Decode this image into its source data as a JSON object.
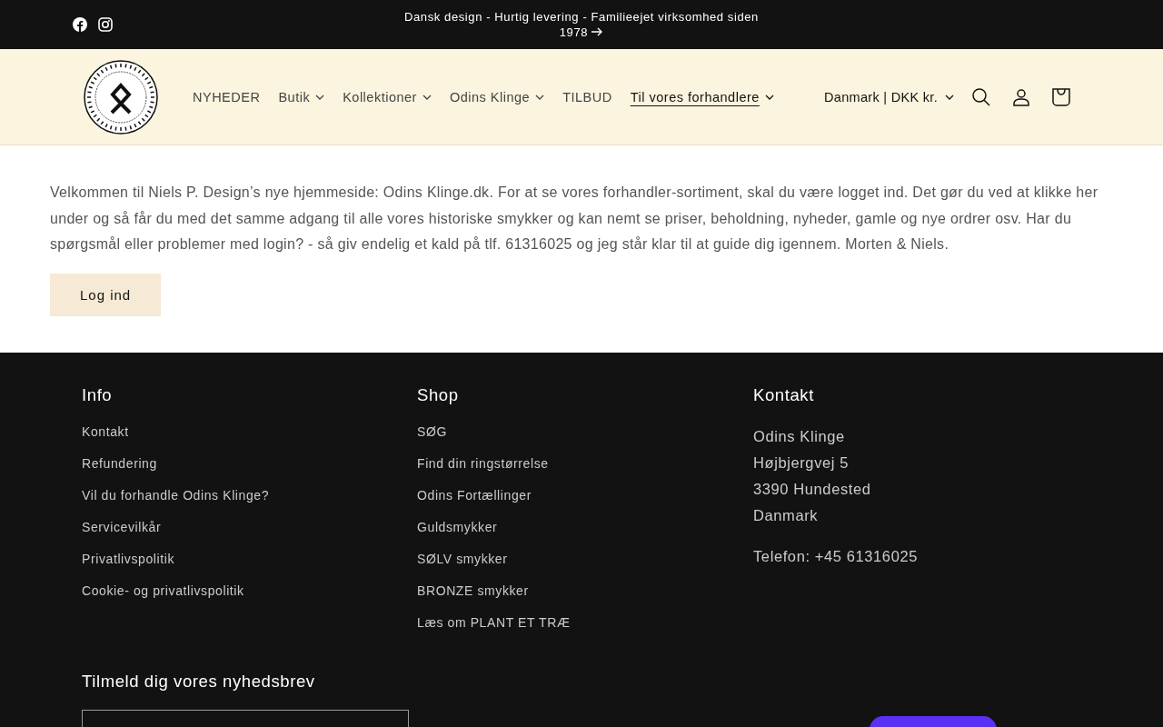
{
  "announcement": {
    "text": "Dansk design - Hurtig levering - Familieejet virksomhed siden 1978"
  },
  "header": {
    "nav": [
      {
        "label": "NYHEDER",
        "dropdown": false,
        "selected": false
      },
      {
        "label": "Butik",
        "dropdown": true,
        "selected": false
      },
      {
        "label": "Kollektioner",
        "dropdown": true,
        "selected": false
      },
      {
        "label": "Odins Klinge",
        "dropdown": true,
        "selected": false
      },
      {
        "label": "TILBUD",
        "dropdown": false,
        "selected": false
      },
      {
        "label": "Til vores forhandlere",
        "dropdown": true,
        "selected": true
      }
    ],
    "locale": "Danmark | DKK kr."
  },
  "main": {
    "text": "Velkommen til Niels P. Design’s nye hjemmeside: Odins Klinge.dk. For at se vores forhandler-sortiment, skal du være logget ind. Det gør du ved at klikke her under og så får du med det samme adgang til alle vores historiske smykker og kan nemt se priser, beholdning, nyheder, gamle og nye ordrer osv. Har du spørgsmål eller problemer med login? - så giv endelig et kald på tlf. 61316025 og jeg står klar til at guide dig igennem. Morten & Niels.",
    "button": "Log ind"
  },
  "footer": {
    "columns": [
      {
        "title": "Info",
        "kind": "links",
        "items": [
          "Kontakt",
          "Refundering",
          "Vil du forhandle Odins Klinge?",
          "Servicevilkår",
          "Privatlivspolitik",
          "Cookie- og privatlivspolitik"
        ]
      },
      {
        "title": "Shop",
        "kind": "links",
        "items": [
          "SØG",
          "Find din ringstørrelse",
          "Odins Fortællinger",
          "Guldsmykker",
          "SØLV smykker",
          "BRONZE smykker",
          "Læs om PLANT ET TRÆ"
        ]
      },
      {
        "title": "Kontakt",
        "kind": "address",
        "items": [
          "Odins Klinge",
          "Højbjergvej 5",
          "3390 Hundested",
          "Danmark",
          "Telefon: +45 61316025"
        ]
      }
    ],
    "newsletter": {
      "title": "Tilmeld dig vores nyhedsbrev"
    }
  }
}
